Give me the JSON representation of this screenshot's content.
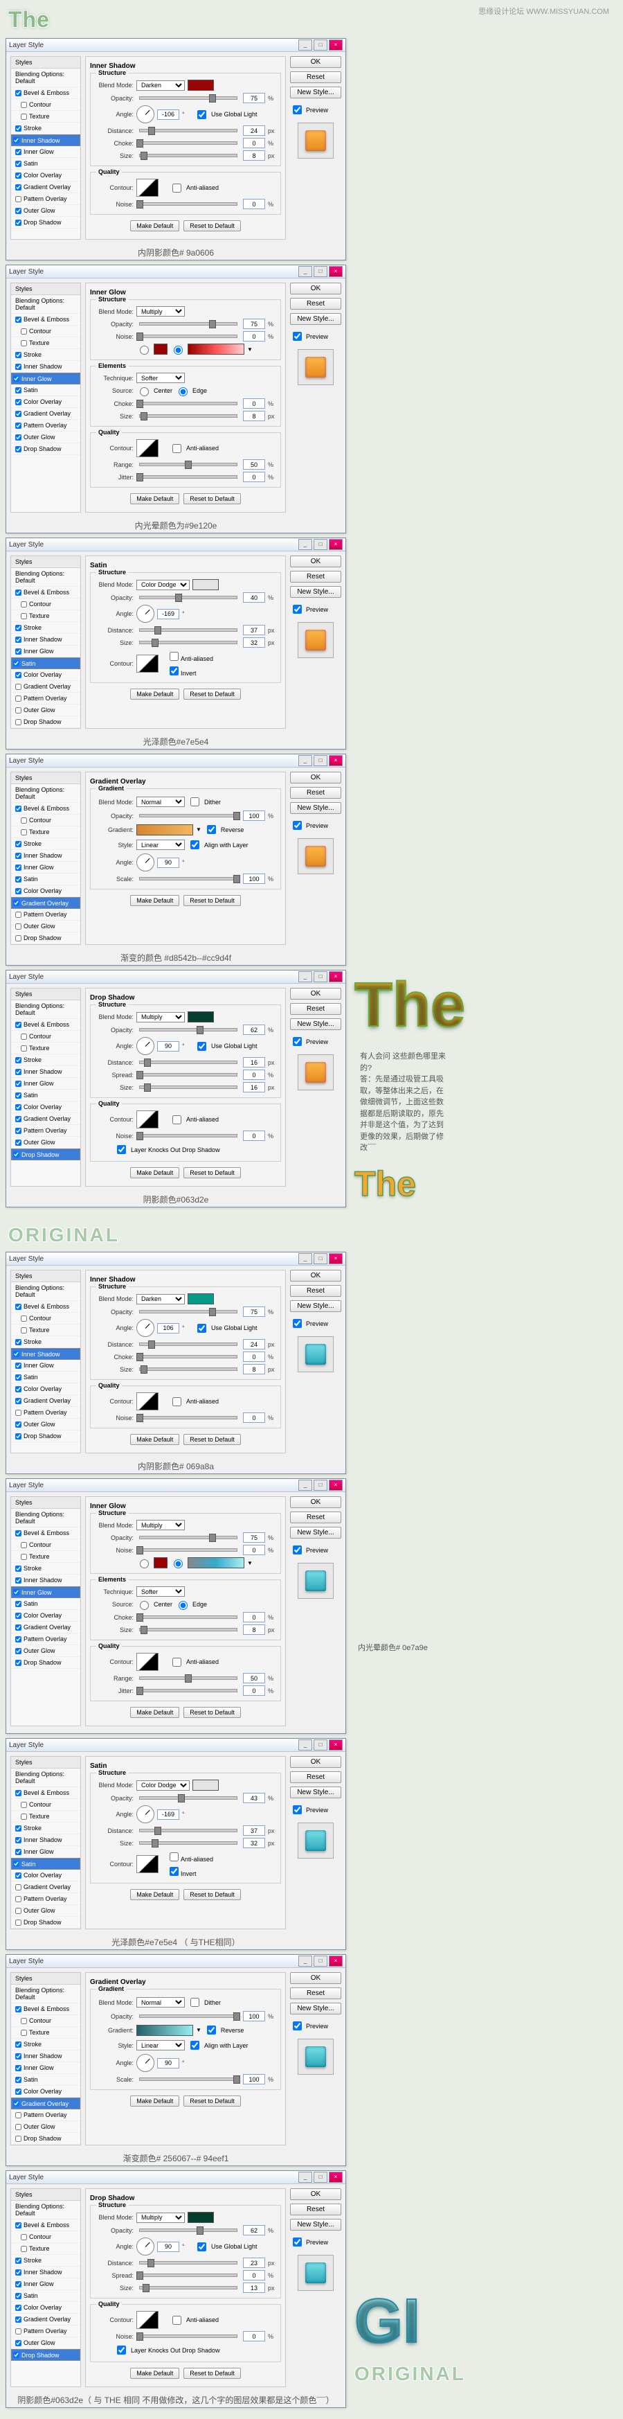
{
  "wm": "思缘设计论坛  WWW.MISSYUAN.COM",
  "hdr": {
    "the": "The",
    "orig": "ORIGINAL"
  },
  "tb": {
    "title": "Layer Style",
    "min": "_",
    "max": "□",
    "close": "×"
  },
  "btns": {
    "ok": "OK",
    "reset": "Reset",
    "new_style": "New Style...",
    "preview": "Preview",
    "make_default": "Make Default",
    "reset_default": "Reset to Default"
  },
  "sb": {
    "hd": "Styles",
    "blending": "Blending Options: Default",
    "bevel": "Bevel & Emboss",
    "contour": "Contour",
    "texture": "Texture",
    "stroke": "Stroke",
    "inner_shadow": "Inner Shadow",
    "inner_glow": "Inner Glow",
    "satin": "Satin",
    "color_overlay": "Color Overlay",
    "gradient_overlay": "Gradient Overlay",
    "pattern_overlay": "Pattern Overlay",
    "outer_glow": "Outer Glow",
    "drop_shadow": "Drop Shadow"
  },
  "labels": {
    "blend_mode": "Blend Mode:",
    "opacity": "Opacity:",
    "angle": "Angle:",
    "use_global": "Use Global Light",
    "distance": "Distance:",
    "choke": "Choke:",
    "spread": "Spread:",
    "size": "Size:",
    "contour": "Contour:",
    "anti_aliased": "Anti-aliased",
    "noise": "Noise:",
    "technique": "Technique:",
    "source": "Source:",
    "center": "Center",
    "edge": "Edge",
    "range": "Range:",
    "jitter": "Jitter:",
    "invert": "Invert",
    "gradient": "Gradient:",
    "reverse": "Reverse",
    "style": "Style:",
    "align": "Align with Layer",
    "scale": "Scale:",
    "layer_knocks": "Layer Knocks Out Drop Shadow",
    "dither": "Dither"
  },
  "modes": {
    "darken": "Darken",
    "multiply": "Multiply",
    "color_dodge": "Color Dodge",
    "normal": "Normal",
    "softer": "Softer",
    "linear": "Linear"
  },
  "sects": {
    "inner_shadow": "Inner Shadow",
    "inner_glow": "Inner Glow",
    "satin": "Satin",
    "gradient_overlay": "Gradient Overlay",
    "drop_shadow": "Drop Shadow",
    "structure": "Structure",
    "quality": "Quality",
    "elements": "Elements",
    "gradient": "Gradient"
  },
  "units": {
    "pct": "%",
    "px": "px",
    "deg": "°"
  },
  "captions": {
    "c1": "内阴影颜色# 9a0606",
    "c2": "内光晕颜色为#9e120e",
    "c3": "光泽颜色#e7e5e4",
    "c4": "渐变的颜色 #d8542b--#cc9d4f",
    "c5": "阴影颜色#063d2e",
    "c6": "内阴影颜色# 069a8a",
    "c7": "内光晕颜色# 0e7a9e",
    "c8": "光泽颜色#e7e5e4 （ 与THE相同）",
    "c9": "渐变颜色# 256067--# 94eef1",
    "c10": "阴影颜色#063d2e（ 与 THE 相同 不用做修改，这几个字的图层效果都是这个颜色¯¯）"
  },
  "note": {
    "q": "有人会问 这些颜色哪里来的?",
    "a": "答：先是通过吸管工具吸取，等整体出来之后，在做细微调节，上面这些数据都是后期读取的，原先并非是这个值，为了达到更像的效果，后期做了修改¯¯"
  },
  "preview_txt": {
    "the": "The",
    "gi": "GI"
  },
  "d": [
    {
      "sel": "inner_shadow",
      "chk": [
        "bevel",
        "stroke",
        "inner_shadow",
        "inner_glow",
        "satin",
        "color_overlay",
        "gradient_overlay",
        "outer_glow",
        "drop_shadow"
      ],
      "swatch": "orange",
      "content": {
        "type": "inner_shadow",
        "mode": "darken",
        "color": "#9a0606",
        "opacity": 75,
        "angle": -106,
        "use_global": true,
        "distance": 24,
        "choke": 0,
        "size": 8,
        "noise": 0
      }
    },
    {
      "sel": "inner_glow",
      "chk": [
        "bevel",
        "stroke",
        "inner_shadow",
        "inner_glow",
        "satin",
        "color_overlay",
        "gradient_overlay",
        "pattern_overlay",
        "outer_glow",
        "drop_shadow"
      ],
      "swatch": "orange",
      "content": {
        "type": "inner_glow",
        "mode": "multiply",
        "opacity": 75,
        "noise": 0,
        "grad": "g-red",
        "tech": "softer",
        "source": "edge",
        "choke": 0,
        "size": 8,
        "range": 50,
        "jitter": 0
      }
    },
    {
      "sel": "satin",
      "chk": [
        "bevel",
        "stroke",
        "inner_shadow",
        "inner_glow",
        "satin",
        "color_overlay"
      ],
      "swatch": "orange",
      "content": {
        "type": "satin",
        "mode": "color_dodge",
        "color": "#e7e5e4",
        "opacity": 40,
        "angle": -169,
        "distance": 37,
        "size": 32,
        "invert": true
      }
    },
    {
      "sel": "gradient_overlay",
      "chk": [
        "bevel",
        "stroke",
        "inner_shadow",
        "inner_glow",
        "satin",
        "color_overlay",
        "gradient_overlay"
      ],
      "swatch": "orange",
      "content": {
        "type": "gradient_overlay",
        "mode": "normal",
        "dither": false,
        "opacity": 100,
        "grad": "g-orange",
        "reverse": true,
        "style": "linear",
        "align": true,
        "angle": 90,
        "scale": 100
      }
    },
    {
      "sel": "drop_shadow",
      "chk": [
        "bevel",
        "stroke",
        "inner_shadow",
        "inner_glow",
        "satin",
        "color_overlay",
        "gradient_overlay",
        "pattern_overlay",
        "outer_glow",
        "drop_shadow"
      ],
      "swatch": "orange",
      "content": {
        "type": "drop_shadow",
        "mode": "multiply",
        "color": "#063d2e",
        "opacity": 62,
        "angle": 90,
        "use_global": true,
        "distance": 16,
        "spread": 0,
        "size": 16,
        "noise": 0,
        "knocks": true
      }
    },
    {
      "sel": "inner_shadow",
      "chk": [
        "bevel",
        "stroke",
        "inner_shadow",
        "inner_glow",
        "satin",
        "color_overlay",
        "gradient_overlay",
        "outer_glow",
        "drop_shadow"
      ],
      "swatch": "cyan",
      "content": {
        "type": "inner_shadow",
        "mode": "darken",
        "color": "#069a8a",
        "opacity": 75,
        "angle": 106,
        "use_global": true,
        "distance": 24,
        "choke": 0,
        "size": 8,
        "noise": 0
      }
    },
    {
      "sel": "inner_glow",
      "chk": [
        "bevel",
        "stroke",
        "inner_shadow",
        "inner_glow",
        "satin",
        "color_overlay",
        "gradient_overlay",
        "pattern_overlay",
        "outer_glow",
        "drop_shadow"
      ],
      "swatch": "cyan",
      "content": {
        "type": "inner_glow",
        "mode": "multiply",
        "opacity": 75,
        "noise": 0,
        "grad": "g-teal",
        "tech": "softer",
        "source": "edge",
        "choke": 0,
        "size": 8,
        "range": 50,
        "jitter": 0
      }
    },
    {
      "sel": "satin",
      "chk": [
        "bevel",
        "stroke",
        "inner_shadow",
        "inner_glow",
        "satin",
        "color_overlay"
      ],
      "swatch": "cyan",
      "content": {
        "type": "satin",
        "mode": "color_dodge",
        "color": "#e7e5e4",
        "opacity": 43,
        "angle": -169,
        "distance": 37,
        "size": 32,
        "invert": true
      }
    },
    {
      "sel": "gradient_overlay",
      "chk": [
        "bevel",
        "stroke",
        "inner_shadow",
        "inner_glow",
        "satin",
        "color_overlay",
        "gradient_overlay"
      ],
      "swatch": "cyan",
      "content": {
        "type": "gradient_overlay",
        "mode": "normal",
        "dither": false,
        "opacity": 100,
        "grad": "g-cyan",
        "reverse": true,
        "style": "linear",
        "align": true,
        "angle": 90,
        "scale": 100
      }
    },
    {
      "sel": "drop_shadow",
      "chk": [
        "bevel",
        "stroke",
        "inner_shadow",
        "inner_glow",
        "satin",
        "color_overlay",
        "gradient_overlay",
        "outer_glow",
        "drop_shadow"
      ],
      "swatch": "cyan",
      "content": {
        "type": "drop_shadow",
        "mode": "multiply",
        "color": "#063d2e",
        "opacity": 62,
        "angle": 90,
        "use_global": true,
        "distance": 23,
        "spread": 0,
        "size": 13,
        "noise": 0,
        "knocks": true
      }
    }
  ]
}
